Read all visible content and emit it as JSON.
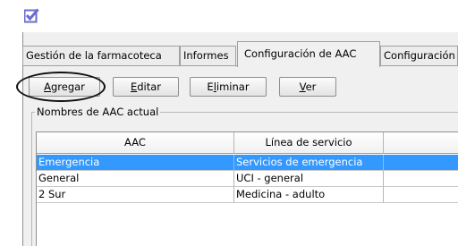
{
  "app": {
    "icon": "checkmark-app-icon"
  },
  "tabs": [
    {
      "label": "Gestión de la farmacoteca"
    },
    {
      "label": "Informes"
    },
    {
      "label": "Configuración de AAC"
    },
    {
      "label": "Configuración"
    }
  ],
  "toolbar": {
    "add_label": "Agregar",
    "edit_label": "Editar",
    "delete_label": "Eliminar",
    "view_label": "Ver"
  },
  "group": {
    "label": "Nombres de AAC actual"
  },
  "table": {
    "columns": [
      "AAC",
      "Línea de servicio",
      ""
    ],
    "rows": [
      {
        "aac": "Emergencia",
        "line": "Servicios de emergencia",
        "selected": true
      },
      {
        "aac": "General",
        "line": "UCI - general"
      },
      {
        "aac": "2 Sur",
        "line": "Medicina - adulto"
      }
    ]
  },
  "colors": {
    "selection": "#3399ff",
    "icon": "#6b6ccf"
  }
}
